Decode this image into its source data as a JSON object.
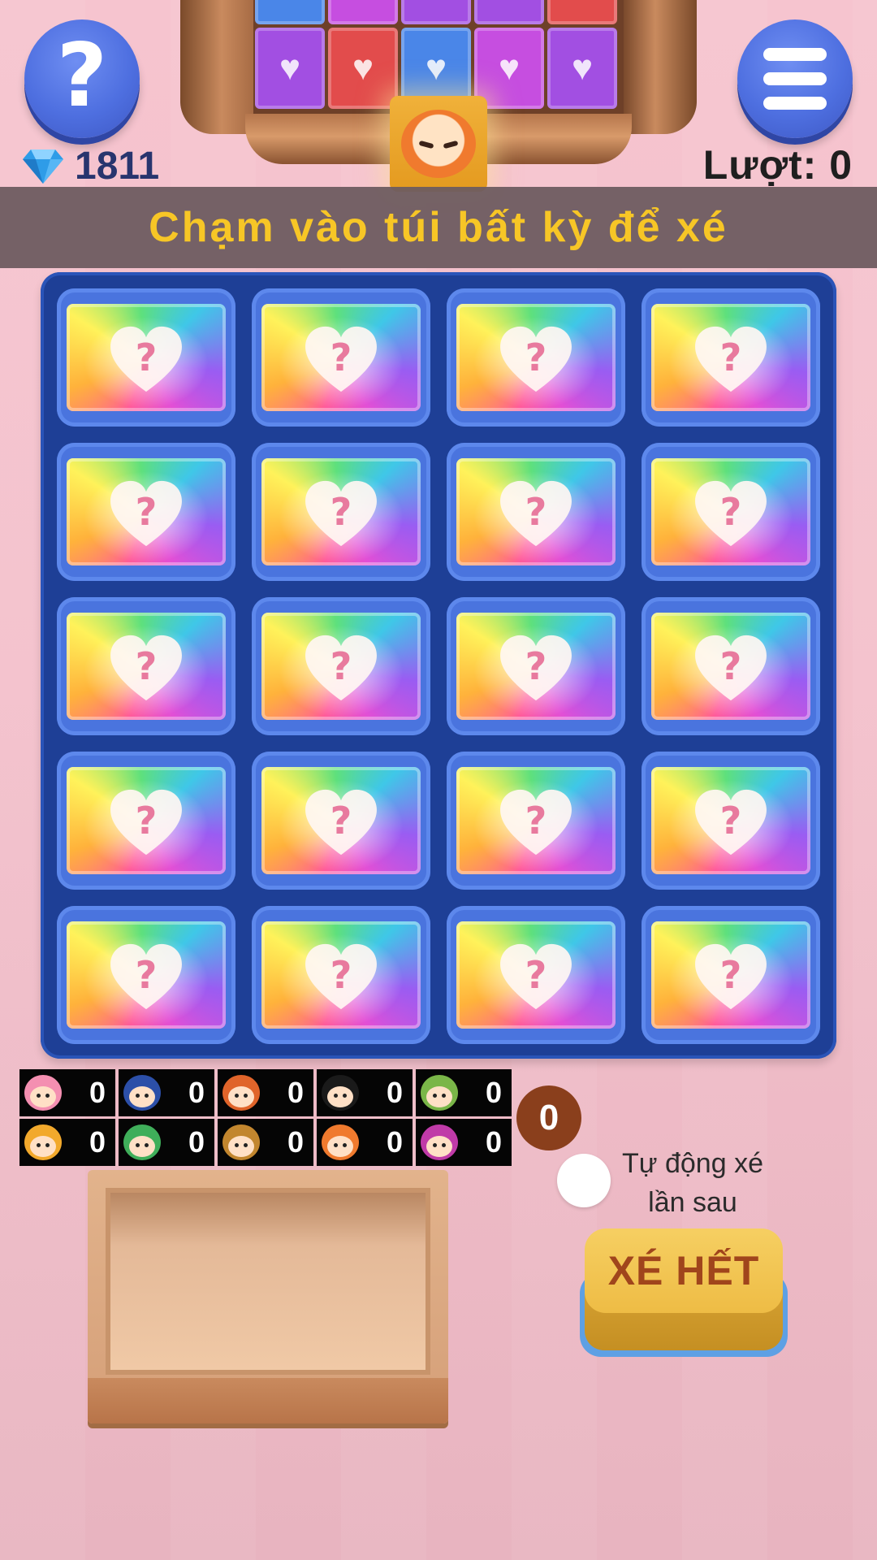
{
  "header": {
    "help_icon": "question-mark-icon",
    "menu_icon": "hamburger-menu-icon",
    "gems": "1811",
    "gem_icon": "diamond-icon",
    "turns": "Lượt: 0"
  },
  "shelf": {
    "packs": [
      {
        "color": "#a24fe2",
        "icon": "heart-icon"
      },
      {
        "color": "#e24c4c",
        "icon": "heart-icon"
      },
      {
        "color": "#4a86e8",
        "icon": "heart-icon"
      },
      {
        "color": "#c64ee0",
        "icon": "heart-icon"
      },
      {
        "color": "#a24fe2",
        "icon": "heart-icon"
      }
    ]
  },
  "banner": {
    "text": "Chạm vào túi bất kỳ để xé"
  },
  "board": {
    "rows": 5,
    "cols": 4,
    "pack_label": "?"
  },
  "characters": [
    {
      "count": "0",
      "hair": "#f48fb1"
    },
    {
      "count": "0",
      "hair": "#2c4fa8"
    },
    {
      "count": "0",
      "hair": "#e0642a"
    },
    {
      "count": "0",
      "hair": "#1a1a1a"
    },
    {
      "count": "0",
      "hair": "#7ab648"
    },
    {
      "count": "0",
      "hair": "#f2a92c"
    },
    {
      "count": "0",
      "hair": "#3fae5a"
    },
    {
      "count": "0",
      "hair": "#c2862e"
    },
    {
      "count": "0",
      "hair": "#f07a2e"
    },
    {
      "count": "0",
      "hair": "#c03aa8"
    }
  ],
  "counter": "0",
  "auto_tear": {
    "label_line1": "Tự động xé",
    "label_line2": "lần sau",
    "checked": false
  },
  "tear_all": {
    "label": "XÉ HẾT"
  },
  "colors": {
    "banner_text": "#f7c626",
    "board": "#1e3f96",
    "slot": "#4a74de",
    "button_blue": "#4e6fe0"
  }
}
